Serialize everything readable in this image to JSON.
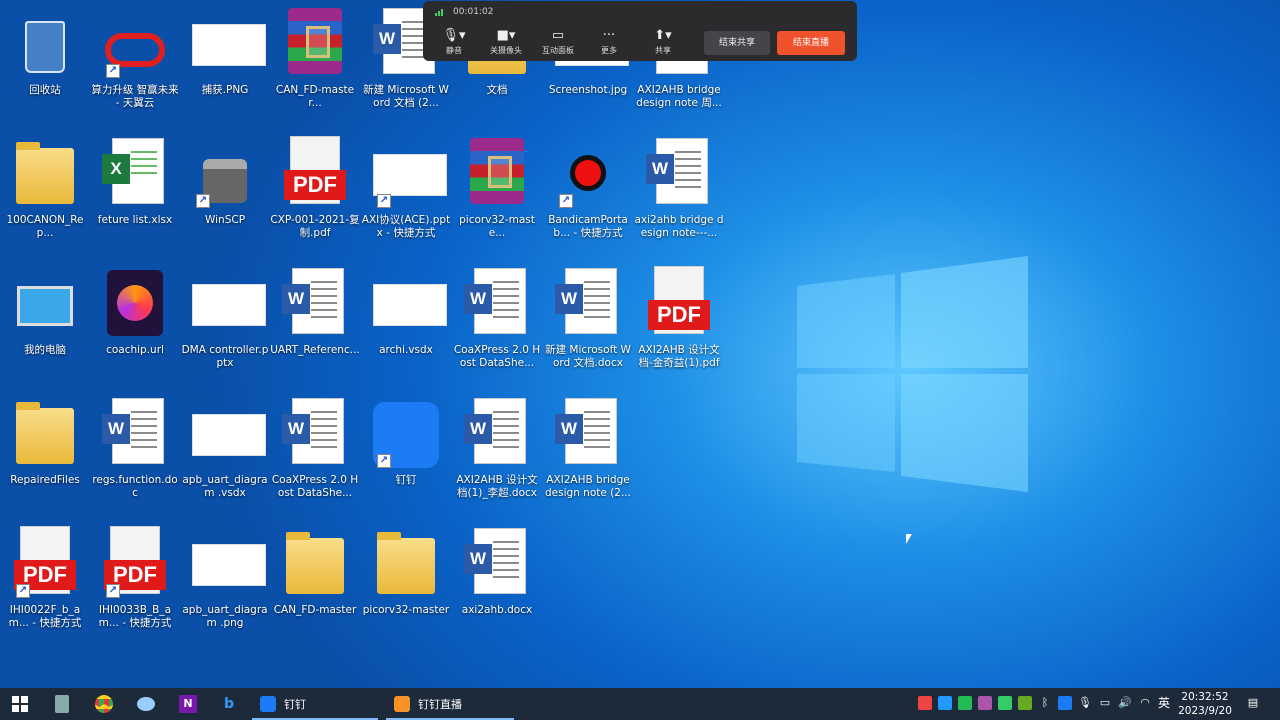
{
  "meeting_bar": {
    "timer": "00:01:02",
    "buttons": [
      {
        "label": "静音",
        "icon": "microphone-icon"
      },
      {
        "label": "关摄像头",
        "icon": "camera-icon"
      },
      {
        "label": "互动面板",
        "icon": "chat-icon"
      },
      {
        "label": "更多",
        "icon": "more-icon"
      },
      {
        "label": "共享",
        "icon": "share-icon"
      }
    ],
    "end_share": "结束共享",
    "end_live": "结束直播"
  },
  "desktop_icons": [
    {
      "label": "回收站",
      "kind": "recycle"
    },
    {
      "label": "算力升级 智赢未来 - 天翼云",
      "kind": "cloud",
      "shortcut": true
    },
    {
      "label": "捕获.PNG",
      "kind": "thumb"
    },
    {
      "label": "CAN_FD-master...",
      "kind": "rar"
    },
    {
      "label": "新建 Microsoft Word 文档 (2...",
      "kind": "word"
    },
    {
      "label": "文档",
      "kind": "folder"
    },
    {
      "label": "Screenshot.jpg",
      "kind": "thumb"
    },
    {
      "label": "AXI2AHB bridge design note 周...",
      "kind": "word"
    },
    {
      "label": "100CANON_Rep...",
      "kind": "folder"
    },
    {
      "label": "feture list.xlsx",
      "kind": "excel"
    },
    {
      "label": "WinSCP",
      "kind": "winscp",
      "shortcut": true
    },
    {
      "label": "CXP-001-2021-复制.pdf",
      "kind": "pdf"
    },
    {
      "label": "AXI协议(ACE).pptx - 快捷方式",
      "kind": "thumb",
      "shortcut": true
    },
    {
      "label": "picorv32-maste...",
      "kind": "rar"
    },
    {
      "label": "BandicamPortab... - 快捷方式",
      "kind": "record",
      "shortcut": true
    },
    {
      "label": "axi2ahb bridge design note---...",
      "kind": "word"
    },
    {
      "label": "我的电脑",
      "kind": "computer"
    },
    {
      "label": "coachip.url",
      "kind": "firefox"
    },
    {
      "label": "DMA controller.pptx",
      "kind": "thumb"
    },
    {
      "label": "UART_Referenc...",
      "kind": "word"
    },
    {
      "label": "archi.vsdx",
      "kind": "thumb"
    },
    {
      "label": "CoaXPress 2.0 Host DataShe...",
      "kind": "word"
    },
    {
      "label": "新建 Microsoft Word 文档.docx",
      "kind": "word"
    },
    {
      "label": "AXI2AHB 设计文档-金奇益(1).pdf",
      "kind": "pdf"
    },
    {
      "label": "RepairedFiles",
      "kind": "folder"
    },
    {
      "label": "regs.function.doc",
      "kind": "word"
    },
    {
      "label": "apb_uart_diagram .vsdx",
      "kind": "thumb"
    },
    {
      "label": "CoaXPress 2.0 Host DataShe...",
      "kind": "word"
    },
    {
      "label": "钉钉",
      "kind": "dingtalk",
      "shortcut": true
    },
    {
      "label": "AXI2AHB 设计文档(1)_李超.docx",
      "kind": "word"
    },
    {
      "label": "AXI2AHB bridge design note (2...",
      "kind": "word"
    },
    {
      "label": "IHI0022F_b_am... - 快捷方式",
      "kind": "pdf",
      "shortcut": true
    },
    {
      "label": "IHI0033B_B_am... - 快捷方式",
      "kind": "pdf",
      "shortcut": true
    },
    {
      "label": "apb_uart_diagram .png",
      "kind": "thumb"
    },
    {
      "label": "CAN_FD-master",
      "kind": "folder"
    },
    {
      "label": "picorv32-master",
      "kind": "folder"
    },
    {
      "label": "axi2ahb.docx",
      "kind": "word"
    }
  ],
  "taskbar": {
    "apps": [
      {
        "label": "钉钉"
      },
      {
        "label": "钉钉直播"
      }
    ],
    "ime": "英",
    "time": "20:32:52",
    "date": "2023/9/20"
  }
}
